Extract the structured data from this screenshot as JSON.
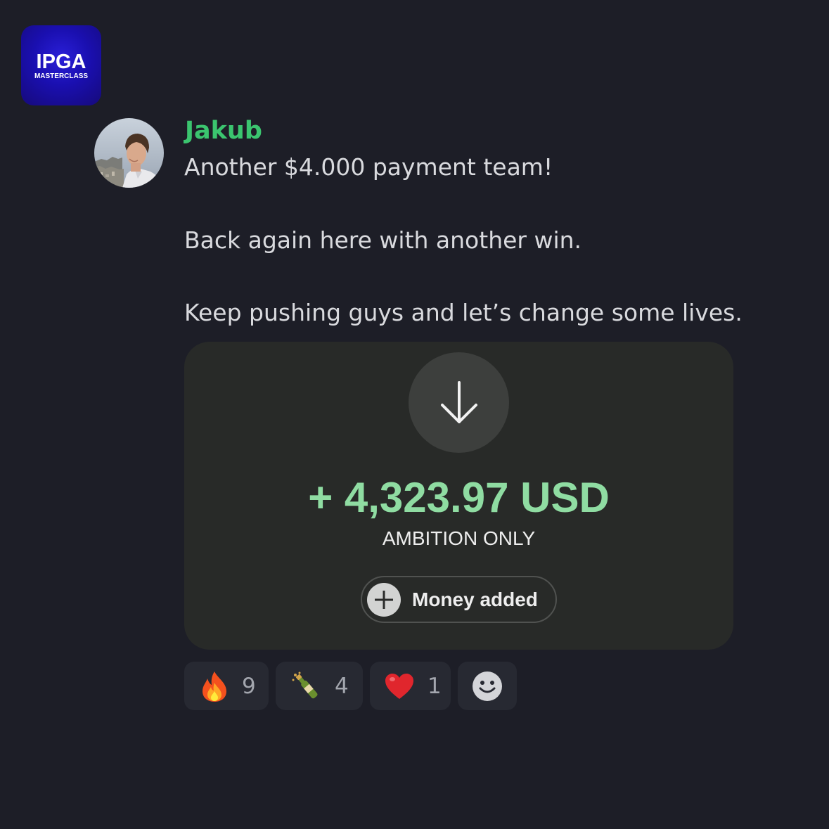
{
  "logo": {
    "title": "IPGA",
    "subtitle": "MASTERCLASS"
  },
  "message": {
    "author": "Jakub",
    "lines": [
      "Another $4.000 payment team!",
      "Back again here with another win.",
      "Keep pushing guys and let’s change some lives."
    ]
  },
  "payment_card": {
    "icon": "arrow-down-icon",
    "amount": "+ 4,323.97 USD",
    "merchant": "AMBITION ONLY",
    "button_label": "Money added",
    "accent_color": "#8fdca2"
  },
  "reactions": [
    {
      "emoji": "fire",
      "count": "9"
    },
    {
      "emoji": "champagne",
      "count": "4"
    },
    {
      "emoji": "heart",
      "count": "1"
    }
  ],
  "add_reaction": {
    "icon": "smiley-icon"
  },
  "colors": {
    "background": "#1d1e27",
    "username": "#3bc56f",
    "card": "#282a28"
  }
}
